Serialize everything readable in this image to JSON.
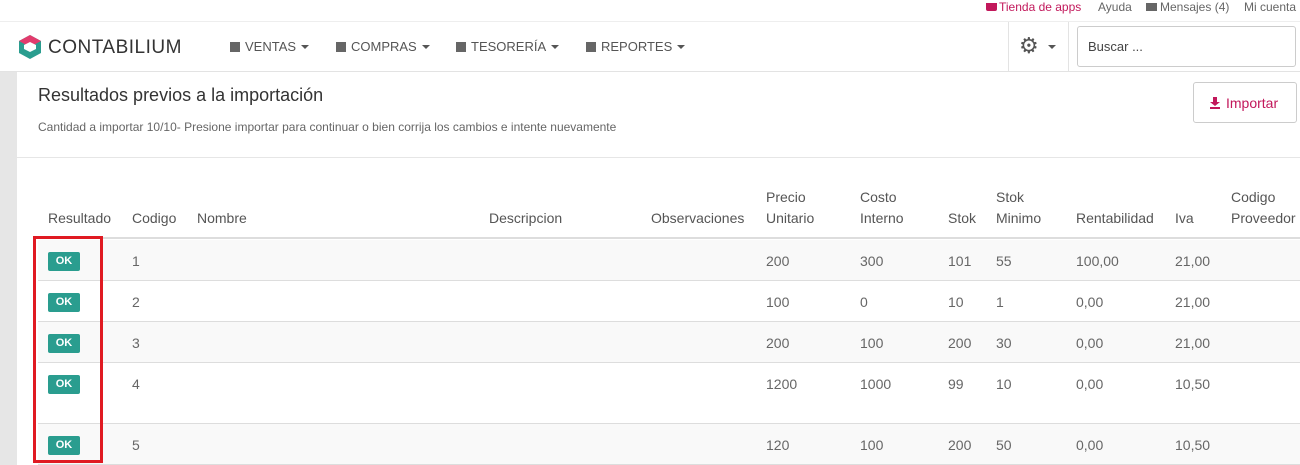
{
  "topbar": {
    "shop": "Tienda de apps",
    "help": "Ayuda",
    "messages": "Mensajes (4)",
    "account": "Mi cuenta"
  },
  "brand": {
    "name": "CONTABILIUM"
  },
  "nav": [
    {
      "label": "VENTAS",
      "icon": "document-icon"
    },
    {
      "label": "COMPRAS",
      "icon": "list-icon"
    },
    {
      "label": "TESORERÍA",
      "icon": "cash-icon"
    },
    {
      "label": "REPORTES",
      "icon": "bar-chart-icon"
    }
  ],
  "search": {
    "placeholder": "Buscar ..."
  },
  "page": {
    "title": "Resultados previos a la importación",
    "subtitle": "Cantidad a importar 10/10- Presione importar para continuar o bien corrija los cambios e intente nuevamente",
    "import_label": "Importar"
  },
  "table": {
    "headers": {
      "resultado": "Resultado",
      "codigo": "Codigo",
      "nombre": "Nombre",
      "descripcion": "Descripcion",
      "observaciones": "Observaciones",
      "precio_1": "Precio",
      "precio_2": "Unitario",
      "costo_1": "Costo",
      "costo_2": "Interno",
      "stok": "Stok",
      "stokmin_1": "Stok",
      "stokmin_2": "Minimo",
      "rentabilidad": "Rentabilidad",
      "iva": "Iva",
      "codprov_1": "Codigo",
      "codprov_2": "Proveedor"
    },
    "rows": [
      {
        "resultado": "OK",
        "codigo": "1",
        "precio": "200",
        "costo": "300",
        "stok": "101",
        "stok_min": "55",
        "rentabilidad": "100,00",
        "iva": "21,00"
      },
      {
        "resultado": "OK",
        "codigo": "2",
        "precio": "100",
        "costo": "0",
        "stok": "10",
        "stok_min": "1",
        "rentabilidad": "0,00",
        "iva": "21,00"
      },
      {
        "resultado": "OK",
        "codigo": "3",
        "precio": "200",
        "costo": "100",
        "stok": "200",
        "stok_min": "30",
        "rentabilidad": "0,00",
        "iva": "21,00"
      },
      {
        "resultado": "OK",
        "codigo": "4",
        "precio": "1200",
        "costo": "1000",
        "stok": "99",
        "stok_min": "10",
        "rentabilidad": "0,00",
        "iva": "10,50"
      },
      {
        "resultado": "OK",
        "codigo": "5",
        "precio": "120",
        "costo": "100",
        "stok": "200",
        "stok_min": "50",
        "rentabilidad": "0,00",
        "iva": "10,50"
      }
    ]
  },
  "colors": {
    "accent": "#c2185b",
    "ok_badge": "#2a9d8f",
    "highlight": "#e01a22"
  }
}
